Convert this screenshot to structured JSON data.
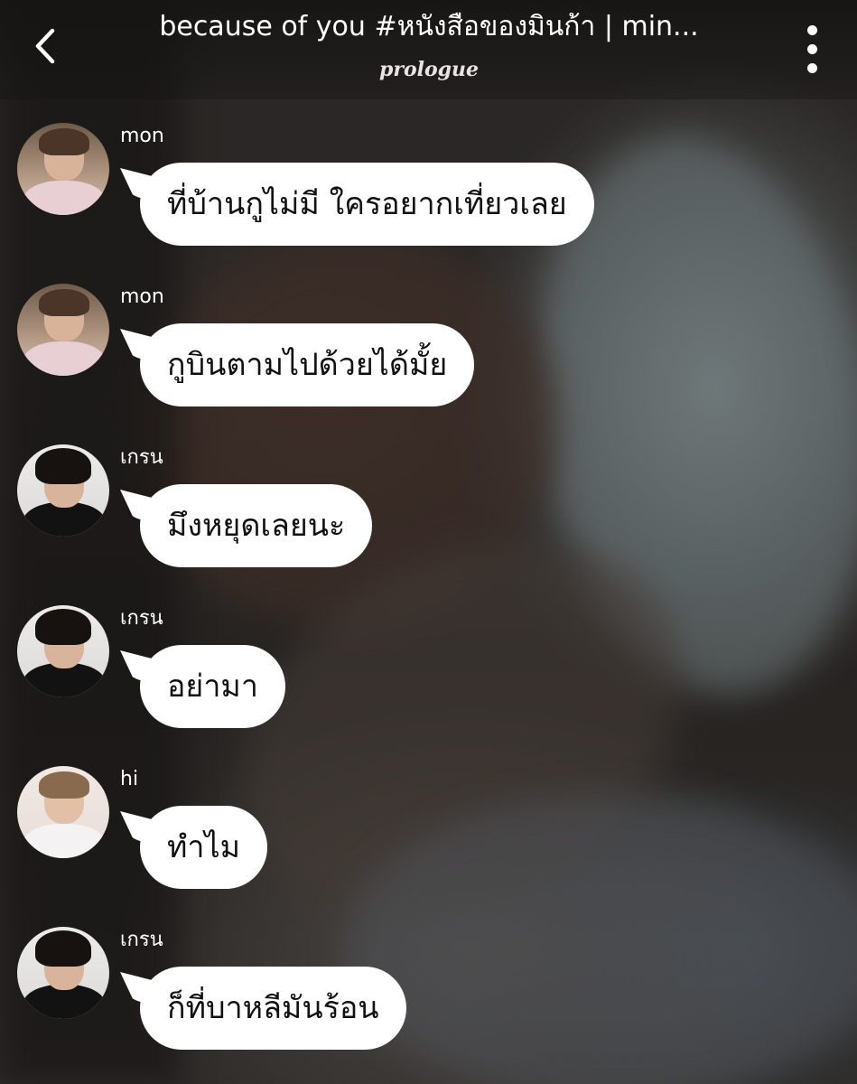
{
  "header": {
    "title": "because of you #หนังสือของมินก้า | min...",
    "subtitle": "prologue"
  },
  "icons": {
    "back": "chevron-left-icon",
    "more": "more-vertical-icon"
  },
  "messages": [
    {
      "sender": "mon",
      "text": "ที่บ้านกูไม่มี ใครอยากเที่ยวเลย"
    },
    {
      "sender": "mon",
      "text": "กูบินตามไปด้วยได้มั้ย"
    },
    {
      "sender": "เกรน",
      "text": "มึงหยุดเลยนะ"
    },
    {
      "sender": "เกรน",
      "text": "อย่ามา"
    },
    {
      "sender": "hi",
      "text": "ทำไม"
    },
    {
      "sender": "เกรน",
      "text": "ก็ที่บาหลีมันร้อน"
    }
  ]
}
